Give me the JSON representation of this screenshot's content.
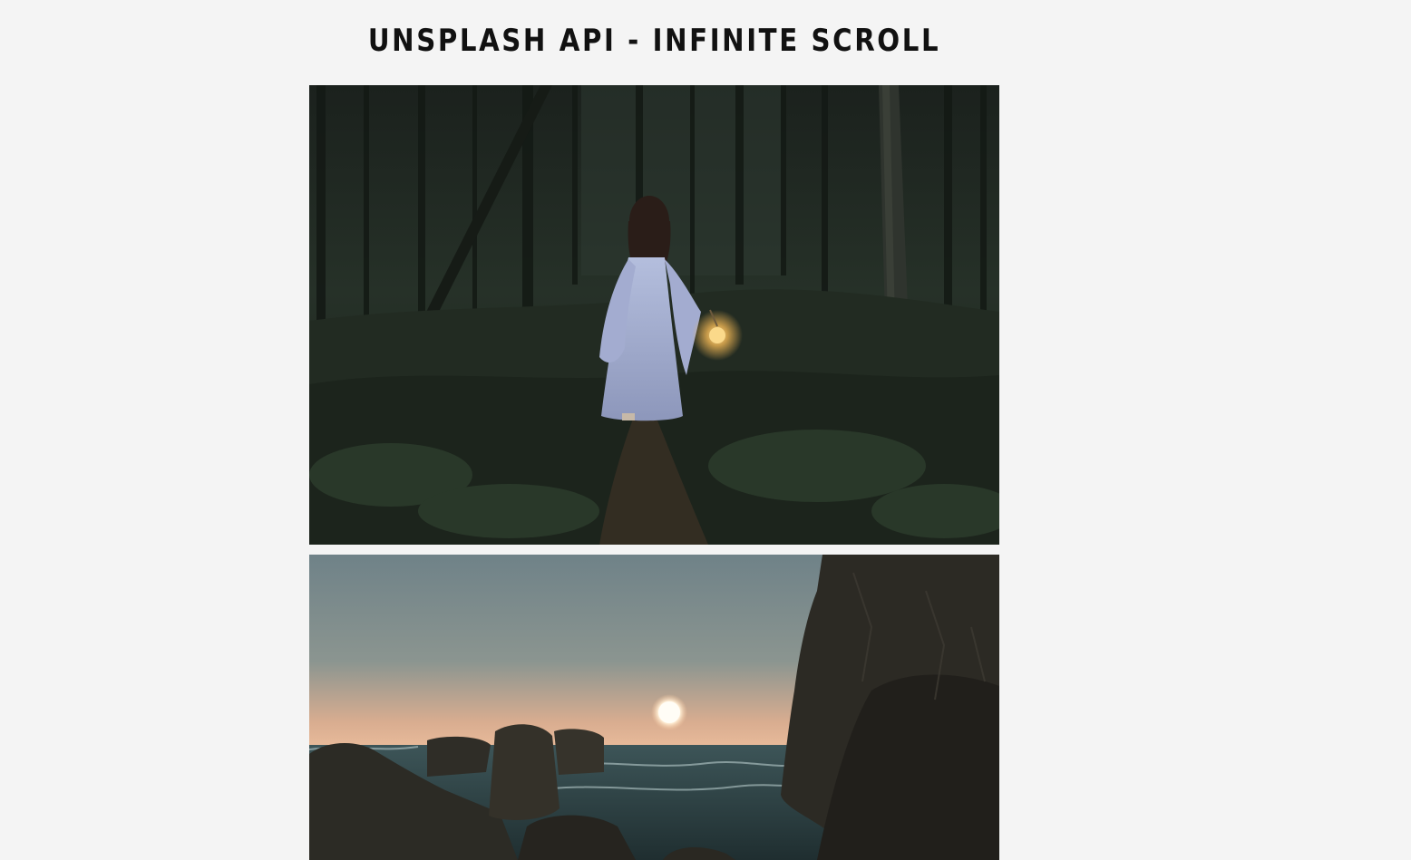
{
  "header": {
    "title": "UNSPLASH API - INFINITE SCROLL"
  },
  "images": [
    {
      "subject": "woman in pale dress with lantern walking through dark forest",
      "palette": [
        "#1a221d",
        "#2c3a30",
        "#a9b3d4",
        "#f3c676"
      ]
    },
    {
      "subject": "sunset over sea between dark rocks and cliffs",
      "palette": [
        "#70848a",
        "#f0b796",
        "#fff3dc",
        "#2a2a26"
      ]
    }
  ]
}
